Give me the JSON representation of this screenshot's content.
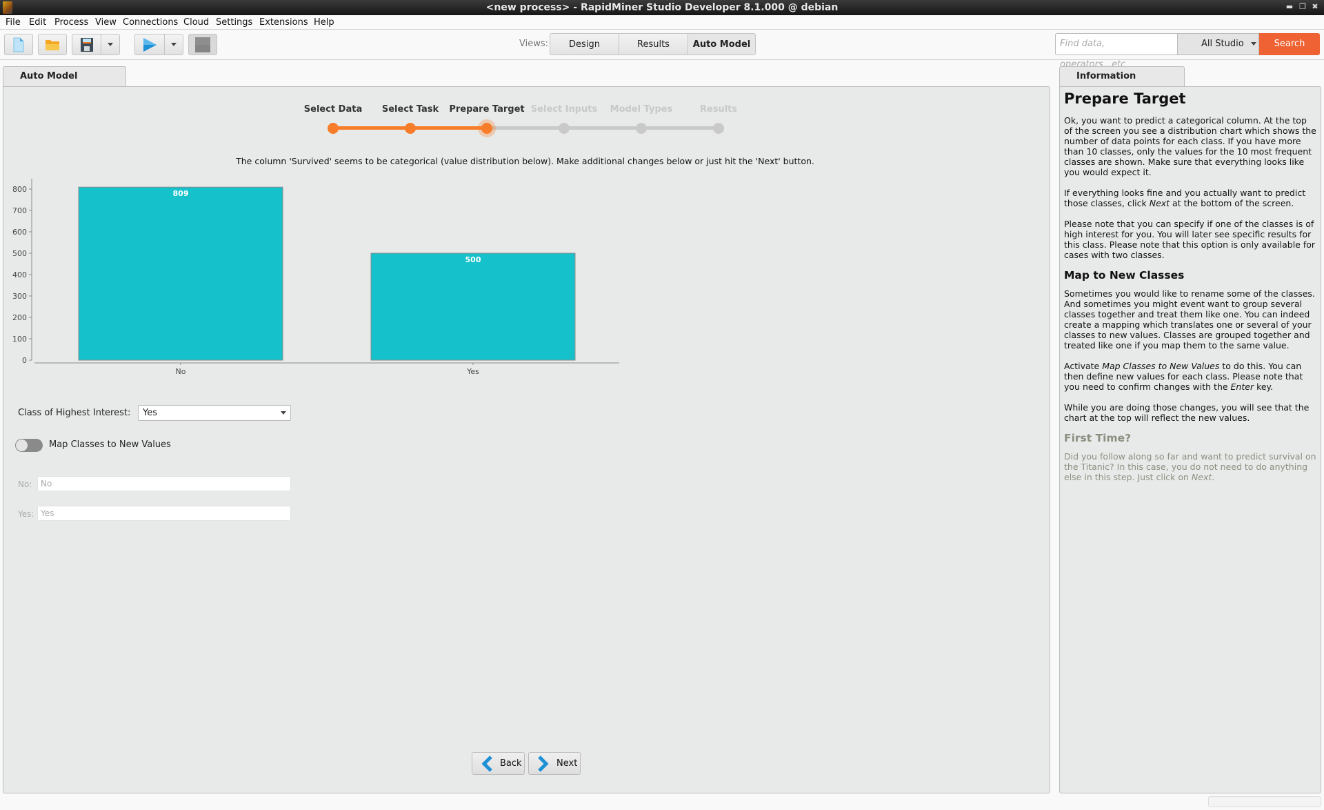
{
  "window": {
    "title": "<new process> - RapidMiner Studio Developer 8.1.000 @ debian",
    "controls": [
      "minimize",
      "maximize",
      "close"
    ]
  },
  "menu": [
    {
      "label": "File",
      "mnemonic": "F"
    },
    {
      "label": "Edit",
      "mnemonic": "E"
    },
    {
      "label": "Process",
      "mnemonic": "P"
    },
    {
      "label": "View",
      "mnemonic": "V"
    },
    {
      "label": "Connections",
      "mnemonic": "C"
    },
    {
      "label": "Cloud",
      "mnemonic": "d"
    },
    {
      "label": "Settings",
      "mnemonic": "S"
    },
    {
      "label": "Extensions",
      "mnemonic": "x"
    },
    {
      "label": "Help",
      "mnemonic": "H"
    }
  ],
  "toolbar": {
    "buttons": [
      "new-process-icon",
      "open-folder-icon",
      "save-icon",
      "run-icon",
      "stop-icon"
    ],
    "views_label": "Views:",
    "views": [
      {
        "label": "Design",
        "active": false
      },
      {
        "label": "Results",
        "active": false
      },
      {
        "label": "Auto Model",
        "active": true
      }
    ],
    "search_placeholder": "Find data, operators...etc",
    "search_scope": "All Studio",
    "search_button": "Search"
  },
  "colors": {
    "accent_orange": "#f77d2a",
    "bar_teal": "#15c2cb",
    "search_button": "#ee6233",
    "step_inactive": "#c9c9c9"
  },
  "main": {
    "tab_label": "Auto Model",
    "steps": [
      {
        "label": "Select Data",
        "state": "done"
      },
      {
        "label": "Select Task",
        "state": "done"
      },
      {
        "label": "Prepare Target",
        "state": "current"
      },
      {
        "label": "Select Inputs",
        "state": "todo"
      },
      {
        "label": "Model Types",
        "state": "todo"
      },
      {
        "label": "Results",
        "state": "todo"
      }
    ],
    "description": "The column 'Survived' seems to be categorical (value distribution below).  Make additional changes below or just hit the 'Next' button.",
    "class_of_interest_label": "Class of Highest Interest:",
    "class_of_interest_value": "Yes",
    "map_toggle_label": "Map Classes to New Values",
    "map_toggle_on": false,
    "mappings": [
      {
        "label": "No:",
        "value": "No"
      },
      {
        "label": "Yes:",
        "value": "Yes"
      }
    ],
    "back_label": "Back",
    "next_label": "Next"
  },
  "chart_data": {
    "type": "bar",
    "title": "",
    "xlabel": "",
    "ylabel": "",
    "categories": [
      "No",
      "Yes"
    ],
    "values": [
      809,
      500
    ],
    "data_labels": [
      "809",
      "500"
    ],
    "yticks": [
      0,
      100,
      200,
      300,
      400,
      500,
      600,
      700,
      800
    ],
    "ylim": [
      0,
      809
    ],
    "grid": false,
    "legend": "none"
  },
  "info": {
    "tab_label": "Information",
    "title": "Prepare Target",
    "p1": "Ok, you want to predict a categorical column. At the top of the screen you see a distribution chart which shows the number of data points for each class. If you have more than 10 classes, only the values for the 10 most frequent classes are shown. Make sure that everything looks like you would expect it.",
    "p2_before": "If everything looks fine and you actually want to predict those classes, click ",
    "p2_em": "Next",
    "p2_after": " at the bottom of the screen.",
    "p3": "Please note that you can specify if one of the classes is of high interest for you. You will later see specific results for this class. Please note that this option is only available for cases with two classes.",
    "h2_map": "Map to New Classes",
    "p4": "Sometimes you would like to rename some of the classes. And sometimes you might event want to group several classes together and treat them like one. You can indeed create a mapping which translates one or several of your classes to new values. Classes are grouped together and treated like one if you map them to the same value.",
    "p5_a": "Activate ",
    "p5_em1": "Map Classes to New Values",
    "p5_b": " to do this. You can then define new values for each class. Please note that you need to confirm changes with the ",
    "p5_em2": "Enter",
    "p5_c": " key.",
    "p6": "While you are doing those changes, you will see that the chart at the top will reflect the new values.",
    "h2_first": "First Time?",
    "p7_before": "Did you follow along so far and want to predict survival on the Titanic? In this case, you do not need to do anything else in this step. Just click on ",
    "p7_em": "Next",
    "p7_after": "."
  }
}
